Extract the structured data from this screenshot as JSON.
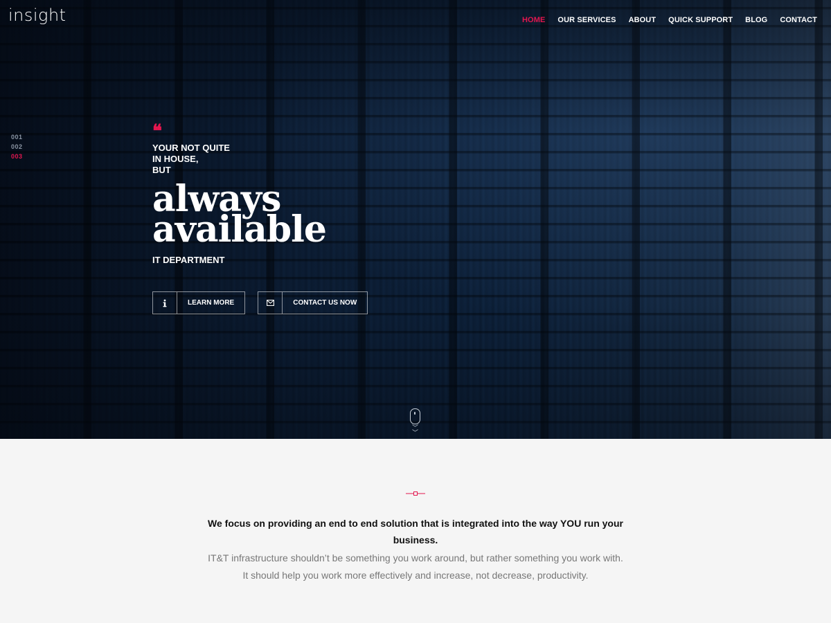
{
  "header": {
    "logo": "insight",
    "nav": [
      "HOME",
      "OUR SERVICES",
      "ABOUT",
      "QUICK SUPPORT",
      "BLOG",
      "CONTACT"
    ],
    "active_nav": "HOME"
  },
  "hero": {
    "slides": [
      "001",
      "002",
      "003"
    ],
    "active_slide": "003",
    "quote_mark": "❝",
    "intro": [
      "YOUR NOT QUITE",
      "IN HOUSE,",
      "BUT"
    ],
    "headline": [
      "always",
      "available"
    ],
    "subheadline": "IT DEPARTMENT",
    "buttons": {
      "learn_more": {
        "label": "LEARN MORE",
        "icon": "info-icon"
      },
      "contact": {
        "label": "CONTACT US NOW",
        "icon": "envelope-icon"
      }
    }
  },
  "section": {
    "focus": "We focus on providing an end to end solution that is integrated into the way YOU run your business.",
    "description": [
      "IT&T infrastructure shouldn’t be something you work around, but rather something you work with.",
      "It should help you work more effectively and increase, not decrease, productivity."
    ]
  },
  "colors": {
    "accent": "#e3164f",
    "hero_overlay": "#0b1828",
    "section_bg": "#f5f5f5",
    "body_text": "#777777"
  }
}
